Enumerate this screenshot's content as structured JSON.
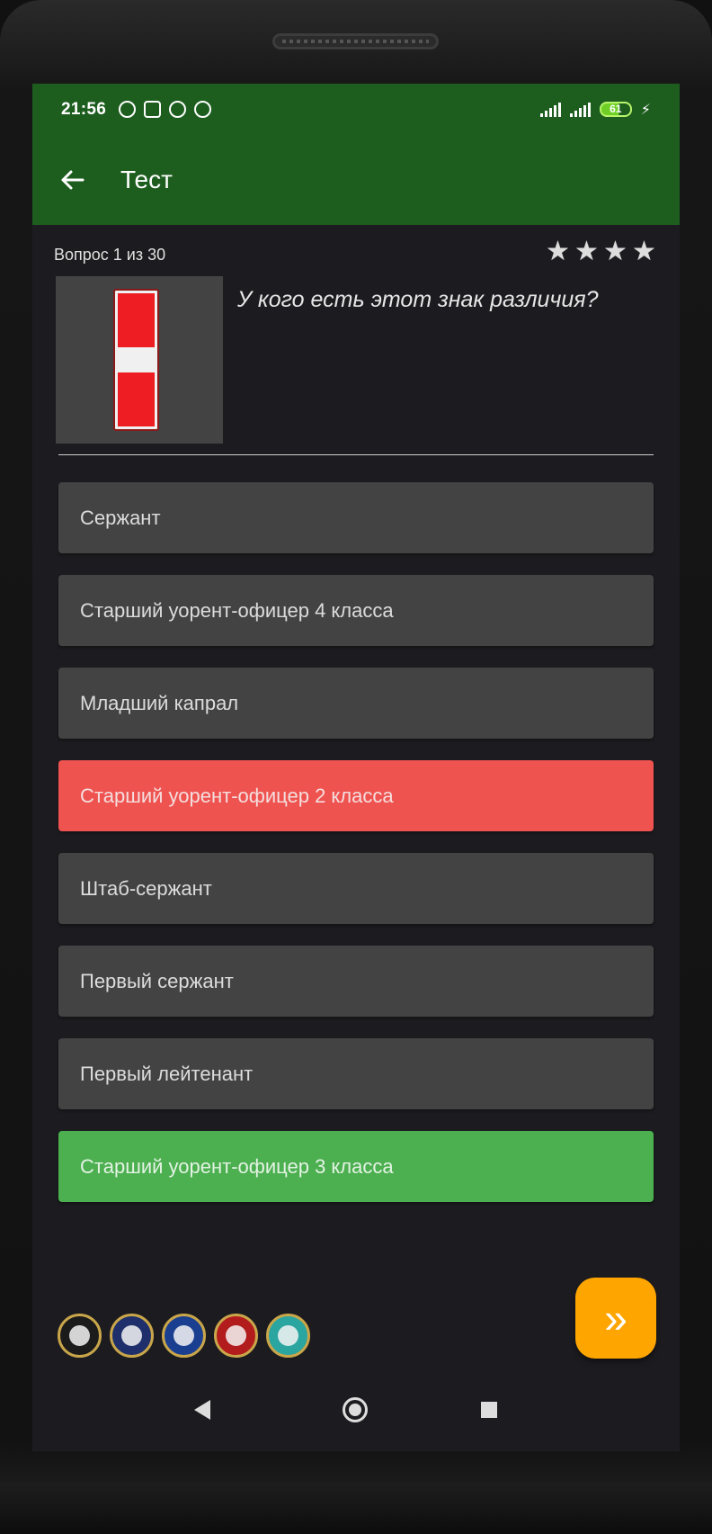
{
  "status_bar": {
    "time": "21:56",
    "icons": [
      "alarm-icon",
      "notification-icon",
      "sync-icon",
      "sync-icon"
    ],
    "battery": "61"
  },
  "app_bar": {
    "title": "Тест",
    "back_icon": "arrow-left-icon"
  },
  "quiz": {
    "counter": "Вопрос 1 из 30",
    "rating_stars": 4,
    "question": "У кого есть этот знак различия?",
    "answers": [
      {
        "label": "Сержант",
        "state": "neutral"
      },
      {
        "label": "Старший уорент-офицер 4 класса",
        "state": "neutral"
      },
      {
        "label": "Младший капрал",
        "state": "neutral"
      },
      {
        "label": "Старший уорент-офицер 2 класса",
        "state": "wrong"
      },
      {
        "label": "Штаб-сержант",
        "state": "neutral"
      },
      {
        "label": "Первый сержант",
        "state": "neutral"
      },
      {
        "label": "Первый лейтенант",
        "state": "neutral"
      },
      {
        "label": "Старший уорент-офицер 3 класса",
        "state": "correct"
      }
    ]
  },
  "emblems": [
    "army-emblem",
    "navy-emblem",
    "air-force-emblem",
    "marine-corps-emblem",
    "coast-guard-emblem"
  ],
  "next_button": {
    "icon": "double-chevron-right-icon",
    "label": "»"
  },
  "colors": {
    "app_bar": "#1d5e1f",
    "background": "#1c1c20",
    "answer": "#434343",
    "wrong": "#ef5350",
    "correct": "#4caf50",
    "next": "#ffa500"
  }
}
